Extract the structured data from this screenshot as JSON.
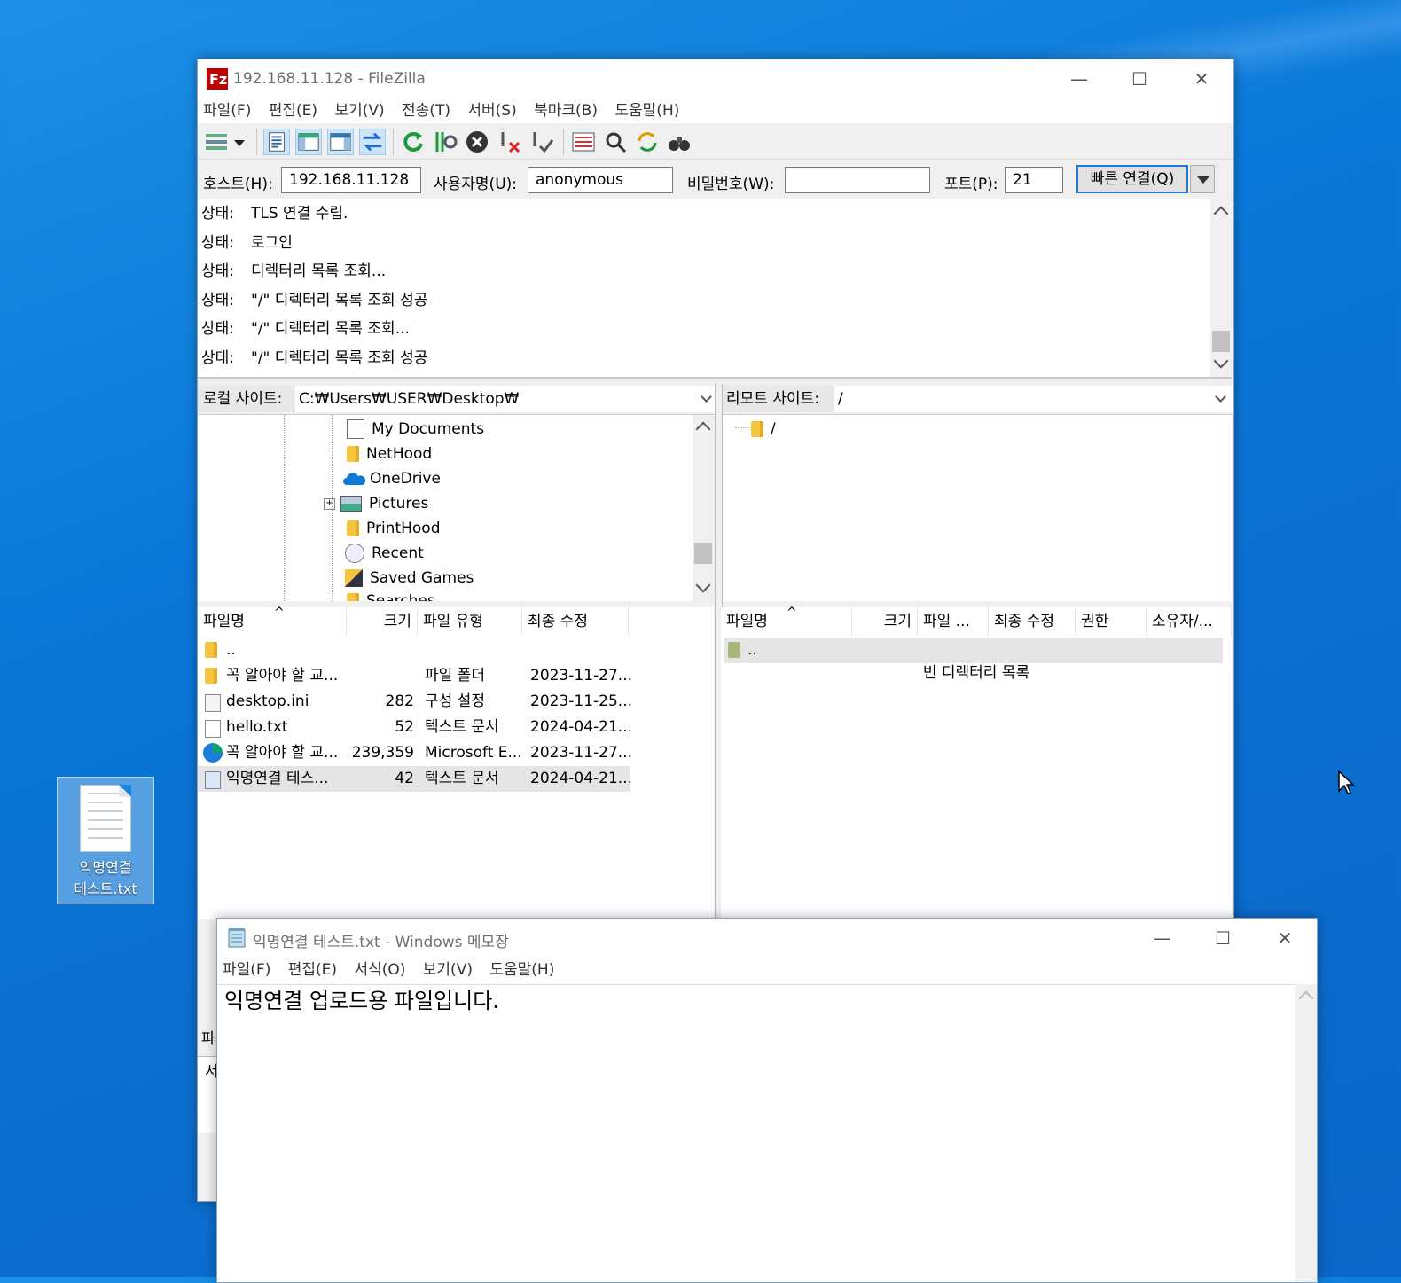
{
  "desktop": {
    "icon_label_line1": "익명연결",
    "icon_label_line2": "테스트.txt"
  },
  "filezilla": {
    "title": "192.168.11.128 - FileZilla",
    "menu": [
      "파일(F)",
      "편집(E)",
      "보기(V)",
      "전송(T)",
      "서버(S)",
      "북마크(B)",
      "도움말(H)"
    ],
    "quickconnect": {
      "host_label": "호스트(H):",
      "host_value": "192.168.11.128",
      "user_label": "사용자명(U):",
      "user_value": "anonymous",
      "pass_label": "비밀번호(W):",
      "pass_value": "",
      "port_label": "포트(P):",
      "port_value": "21",
      "connect_button": "빠른 연결(Q)"
    },
    "log": [
      {
        "k": "상태:",
        "v": "TLS 연결 수립."
      },
      {
        "k": "상태:",
        "v": "로그인"
      },
      {
        "k": "상태:",
        "v": "디렉터리 목록 조회..."
      },
      {
        "k": "상태:",
        "v": "\"/\" 디렉터리 목록 조회 성공"
      },
      {
        "k": "상태:",
        "v": "\"/\" 디렉터리 목록 조회..."
      },
      {
        "k": "상태:",
        "v": "\"/\" 디렉터리 목록 조회 성공"
      }
    ],
    "local": {
      "label": "로컬 사이트:",
      "path": "C:₩Users₩USER₩Desktop₩",
      "tree": [
        "My Documents",
        "NetHood",
        "OneDrive",
        "Pictures",
        "PrintHood",
        "Recent",
        "Saved Games",
        "Searches"
      ],
      "columns": [
        "파일명",
        "크기",
        "파일 유형",
        "최종 수정"
      ],
      "files": [
        {
          "name": "..",
          "size": "",
          "type": "",
          "modified": ""
        },
        {
          "name": "꼭 알아야 할 교...",
          "size": "",
          "type": "파일 폴더",
          "modified": "2023-11-27..."
        },
        {
          "name": "desktop.ini",
          "size": "282",
          "type": "구성 설정",
          "modified": "2023-11-25..."
        },
        {
          "name": "hello.txt",
          "size": "52",
          "type": "텍스트 문서",
          "modified": "2024-04-21..."
        },
        {
          "name": "꼭 알아야 할 교...",
          "size": "239,359",
          "type": "Microsoft E...",
          "modified": "2023-11-27..."
        },
        {
          "name": "익명연결 테스...",
          "size": "42",
          "type": "텍스트 문서",
          "modified": "2024-04-21..."
        }
      ]
    },
    "remote": {
      "label": "리모트 사이트:",
      "path": "/",
      "tree": [
        "/"
      ],
      "columns": [
        "파일명",
        "크기",
        "파일 ...",
        "최종 수정",
        "권한",
        "소유자/..."
      ],
      "files": [
        {
          "name": ".."
        }
      ],
      "empty_message": "빈 디렉터리 목록"
    },
    "bottom_fragments": [
      "파",
      "서"
    ]
  },
  "notepad": {
    "title": "익명연결 테스트.txt - Windows 메모장",
    "menu": [
      "파일(F)",
      "편집(E)",
      "서식(O)",
      "보기(V)",
      "도움말(H)"
    ],
    "content": "익명연결 업로드용 파일입니다."
  }
}
